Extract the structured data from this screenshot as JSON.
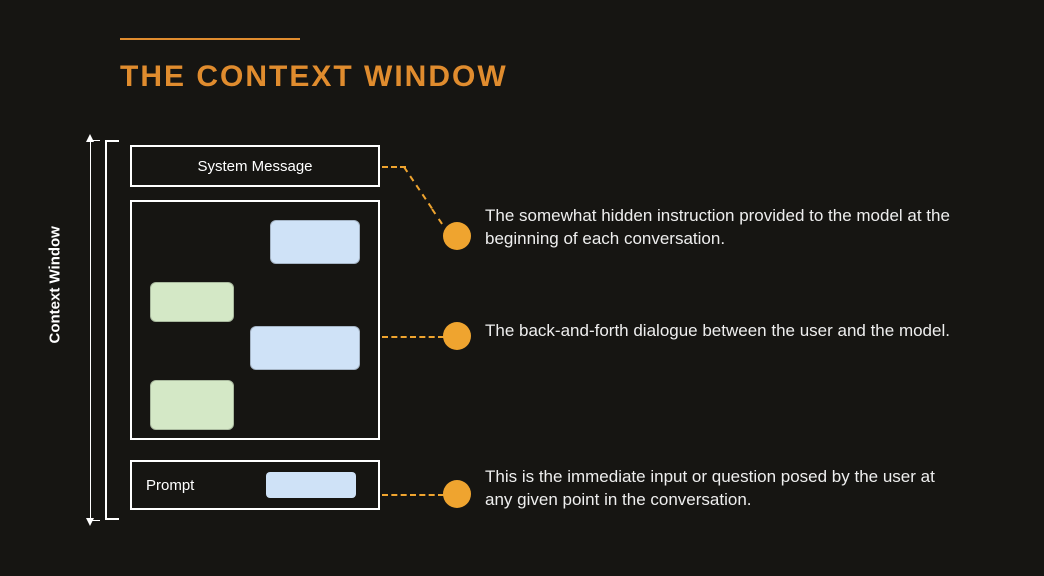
{
  "title": "THE CONTEXT WINDOW",
  "axis_label": "Context Window",
  "system_message_label": "System Message",
  "prompt_label": "Prompt",
  "descriptions": {
    "system": "The somewhat hidden instruction provided to the model at the beginning of each conversation.",
    "conversation": "The back-and-forth dialogue between the user and the model.",
    "prompt": "This is the immediate input or question posed by the user at any given point in the conversation."
  },
  "colors": {
    "accent": "#e08c2e",
    "dot": "#efa42f",
    "user_bubble": "#cfe2f7",
    "model_bubble": "#d4e8c6",
    "background": "#161512"
  }
}
